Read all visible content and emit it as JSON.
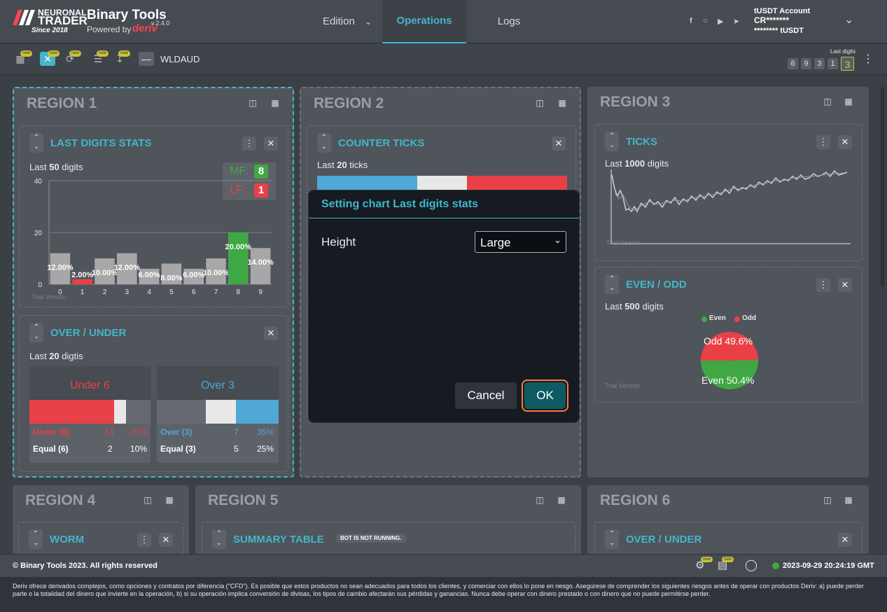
{
  "brand": {
    "line1": "NEURONAL",
    "line2": "TRADER",
    "since": "Since 2018",
    "app_title": "Binary Tools",
    "version": "v.2.4.0",
    "powered": "Powered by",
    "deriv": "deriv"
  },
  "nav": {
    "edition": "Edition",
    "operations": "Operations",
    "logs": "Logs"
  },
  "account": {
    "name": "tUSDT Account",
    "id": "CR*******",
    "balance": "******** tUSDT"
  },
  "toolbar": {
    "new_badge": "new",
    "symbol": "WLDAUD",
    "last_digits_label": "Last digits",
    "last_digits": [
      "6",
      "9",
      "3",
      "1",
      "3"
    ]
  },
  "regions": [
    "REGION 1",
    "REGION 2",
    "REGION 3",
    "REGION 4",
    "REGION 5",
    "REGION 6"
  ],
  "last_digits_stats": {
    "title": "LAST DIGITS STATS",
    "subtitle_pre": "Last",
    "subtitle_num": "50",
    "subtitle_post": "digits",
    "mf_label": "MF:",
    "mf_value": "8",
    "lf_label": "LF:",
    "lf_value": "1",
    "trial": "Trial Version"
  },
  "chart_data": {
    "type": "bar",
    "categories": [
      "0",
      "1",
      "2",
      "3",
      "4",
      "5",
      "6",
      "7",
      "8",
      "9"
    ],
    "values": [
      12,
      2,
      10,
      12,
      6,
      8,
      6,
      10,
      20,
      14
    ],
    "data_labels": [
      "12.00%",
      "2.00%",
      "10.00%",
      "12.00%",
      "6.00%",
      "8.00%",
      "6.00%",
      "10.00%",
      "20.00%",
      "14.00%"
    ],
    "yticks": [
      "0",
      "20",
      "40"
    ],
    "ylim": [
      0,
      40
    ],
    "colors": {
      "default": "#a7a7a7",
      "max": "#3fa845",
      "min": "#e94047"
    }
  },
  "over_under": {
    "title": "OVER / UNDER",
    "subtitle_pre": "Last",
    "subtitle_num": "20",
    "subtitle_post": "digtis",
    "under_title": "Under 6",
    "under_label": "Under (6)",
    "under_count": "14",
    "under_pct": "70%",
    "under_equal_label": "Equal (6)",
    "under_equal_count": "2",
    "under_equal_pct": "10%",
    "under_fill": 0.7,
    "under_equal_fill": 0.1,
    "over_title": "Over 3",
    "over_label": "Over (3)",
    "over_count": "7",
    "over_pct": "35%",
    "over_equal_label": "Equal (3)",
    "over_equal_count": "5",
    "over_equal_pct": "25%",
    "over_fill": 0.35,
    "over_equal_fill": 0.25
  },
  "counter_ticks": {
    "title": "COUNTER TICKS",
    "subtitle_pre": "Last",
    "subtitle_num": "20",
    "subtitle_post": "ticks"
  },
  "ticks": {
    "title": "TICKS",
    "subtitle_pre": "Last",
    "subtitle_num": "1000",
    "subtitle_post": "digits",
    "trial": "Trial Version"
  },
  "even_odd": {
    "title": "EVEN / ODD",
    "subtitle_pre": "Last",
    "subtitle_num": "500",
    "subtitle_post": "digits",
    "legend_even": "Even",
    "legend_odd": "Odd",
    "odd_label": "Odd 49.6%",
    "even_label": "Even 50.4%",
    "odd_fraction": 0.496,
    "even_fraction": 0.504,
    "trial": "Trial Version"
  },
  "worm": {
    "title": "WORM"
  },
  "summary": {
    "title": "SUMMARY TABLE",
    "badge": "BOT IS NOT RUNNING."
  },
  "over_under_2": {
    "title": "OVER / UNDER"
  },
  "dialog": {
    "title": "Setting chart Last digits stats",
    "height_label": "Height",
    "height_value": "Large",
    "height_options": [
      "Small",
      "Medium",
      "Large"
    ],
    "cancel": "Cancel",
    "ok": "OK"
  },
  "footer": {
    "copyright": "© Binary Tools 2023. All rights reserved",
    "datetime": "2023-09-29 20:24:19 GMT",
    "disclaimer": "Deriv ofrece derivados complejos, como opciones y contratos por diferencia (\"CFD\"). Es posible que estos productos no sean adecuados para todos los clientes, y comerciar con ellos lo pone en riesgo. Asegúrese de comprender los siguientes riesgos antes de operar con productos Deriv: a) puede perder parte o la totalidad del dinero que invierte en la operación, b) si su operación implica conversión de divisas, los tipos de cambio afectarán sus pérdidas y ganancias. Nunca debe operar con dinero prestado o con dinero que no puede permitirse perder."
  }
}
